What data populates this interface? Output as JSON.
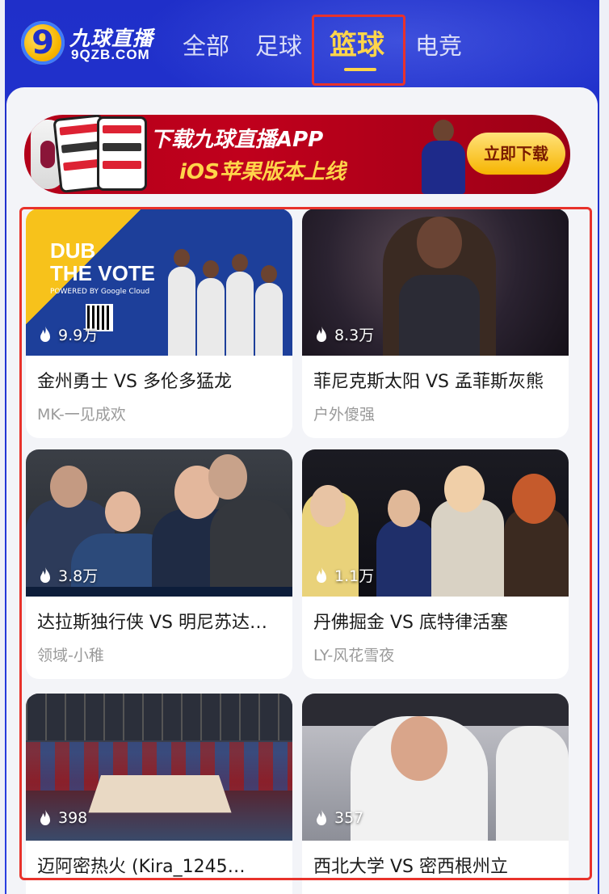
{
  "header": {
    "logo_name": "九球直播",
    "logo_domain": "9QZB.COM",
    "tabs": [
      {
        "label": "全部",
        "active": false
      },
      {
        "label": "足球",
        "active": false
      },
      {
        "label": "篮球",
        "active": true
      },
      {
        "label": "电竞",
        "active": false
      }
    ]
  },
  "banner": {
    "line1": "下载九球直播APP",
    "line2": "iOS苹果版本上线",
    "button": "立即下载"
  },
  "thumb_text": {
    "dub_line1": "DUB",
    "dub_line2": "THE VOTE",
    "powered": "POWERED BY Google Cloud"
  },
  "cards": [
    {
      "heat": "9.9万",
      "title": "金州勇士 VS 多伦多猛龙",
      "author": "MK-一见成欢"
    },
    {
      "heat": "8.3万",
      "title": "菲尼克斯太阳 VS 孟菲斯灰熊",
      "author": "户外傻强"
    },
    {
      "heat": "3.8万",
      "title": "达拉斯独行侠 VS 明尼苏达森林狼",
      "author": "领域-小稚"
    },
    {
      "heat": "1.1万",
      "title": "丹佛掘金 VS 底特律活塞",
      "author": "LY-风花雪夜"
    },
    {
      "heat": "398",
      "title": "迈阿密热火 (Kira_1245…",
      "author": ""
    },
    {
      "heat": "357",
      "title": "西北大学 VS 密西根州立",
      "author": ""
    }
  ],
  "colors": {
    "header_blue": "#2438d8",
    "active_tab": "#ffd54a",
    "highlight_red": "#e8322b",
    "banner_red": "#c0001c"
  }
}
